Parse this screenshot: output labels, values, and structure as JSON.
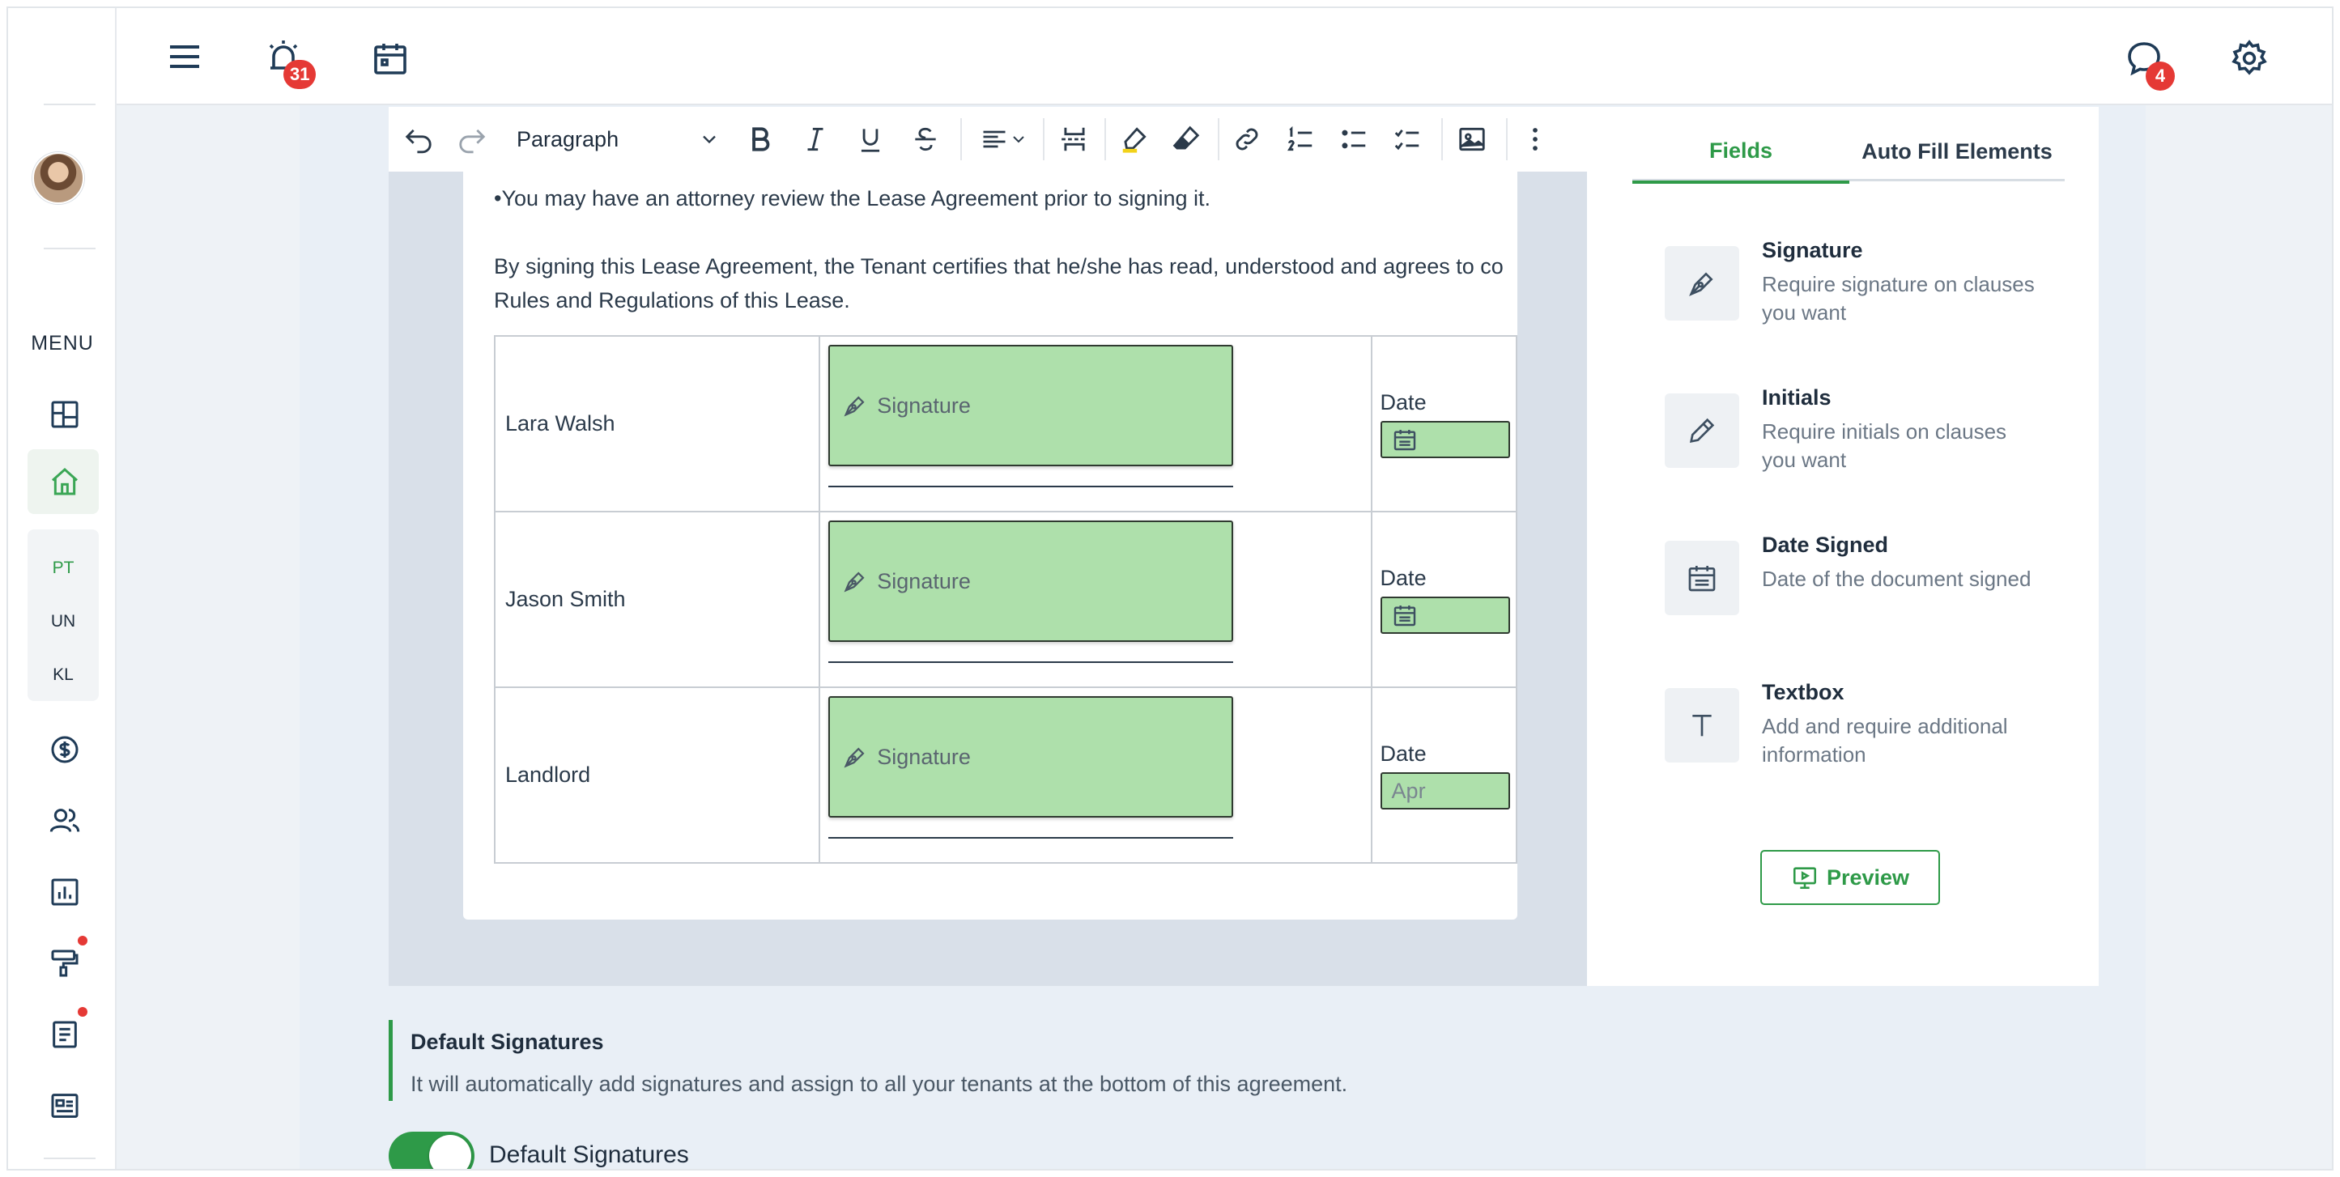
{
  "sidebar": {
    "menu_label": "MENU",
    "tenants": [
      "PT",
      "UN",
      "KL"
    ]
  },
  "topbar": {
    "alerts_count": "31",
    "messages_count": "4"
  },
  "toolbar": {
    "paragraph_style": "Paragraph"
  },
  "document": {
    "bullet_line": "•You may have an attorney review the Lease Agreement prior to signing it.",
    "certify_line_1": "By signing this Lease Agreement, the Tenant certifies that he/she has read, understood and agrees to co",
    "certify_line_2": "Rules and Regulations of this Lease.",
    "signers": [
      {
        "name": "Lara Walsh",
        "signature_label": "Signature",
        "date_label": "Date",
        "date_value": "",
        "show_calendar_icon": true
      },
      {
        "name": "Jason Smith",
        "signature_label": "Signature",
        "date_label": "Date",
        "date_value": "",
        "show_calendar_icon": true
      },
      {
        "name": "Landlord",
        "signature_label": "Signature",
        "date_label": "Date",
        "date_value": "Apr",
        "show_calendar_icon": false
      }
    ]
  },
  "panel": {
    "tabs": [
      {
        "label": "Fields",
        "active": true
      },
      {
        "label": "Auto Fill Elements",
        "active": false
      }
    ],
    "fields": [
      {
        "title": "Signature",
        "description": "Require signature on clauses you want",
        "icon": "pen-nib-icon"
      },
      {
        "title": "Initials",
        "description": "Require initials on clauses you want",
        "icon": "pencil-icon"
      },
      {
        "title": "Date Signed",
        "description": "Date of the document signed",
        "icon": "calendar-icon"
      },
      {
        "title": "Textbox",
        "description": "Add and require additional information",
        "icon": "text-icon"
      }
    ],
    "preview_label": "Preview"
  },
  "default_signatures": {
    "title": "Default Signatures",
    "description": "It will automatically add signatures and assign to all your tenants at the bottom of this agreement.",
    "toggle_label": "Default Signatures",
    "toggle_on": true
  },
  "colors": {
    "accent": "#2e9a48",
    "badge": "#e53935",
    "signature_fill": "#aee0ab"
  }
}
